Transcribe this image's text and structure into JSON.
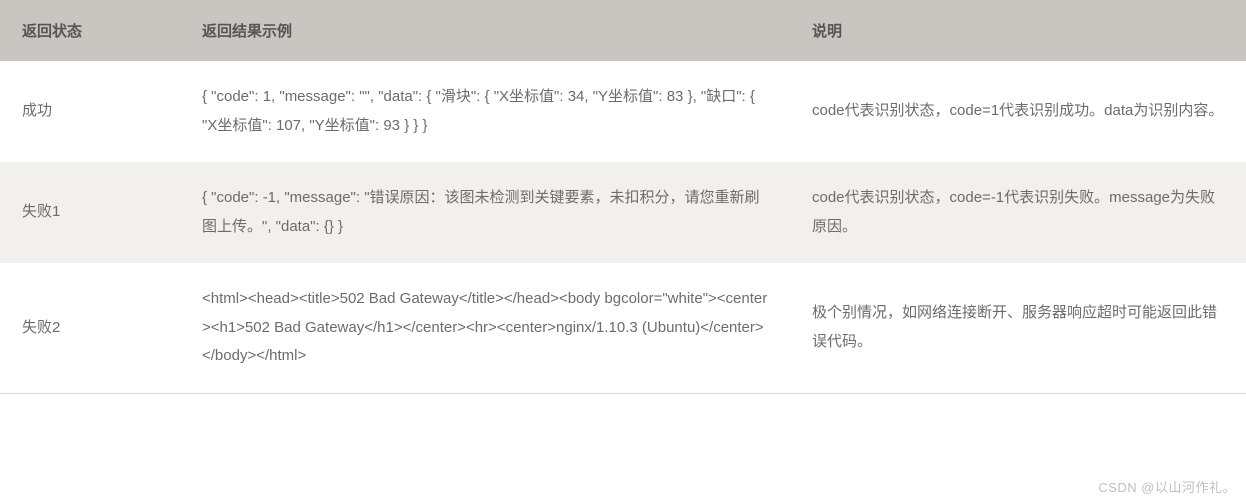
{
  "table": {
    "headers": {
      "status": "返回状态",
      "example": "返回结果示例",
      "description": "说明"
    },
    "rows": [
      {
        "status": "成功",
        "example": "{ \"code\": 1, \"message\": \"\", \"data\": { \"滑块\": { \"X坐标值\": 34, \"Y坐标值\": 83 }, \"缺口\": { \"X坐标值\": 107, \"Y坐标值\": 93 } } }",
        "description": "code代表识别状态，code=1代表识别成功。data为识别内容。"
      },
      {
        "status": "失败1",
        "example": "{ \"code\": -1, \"message\": \"错误原因：该图未检测到关键要素，未扣积分，请您重新刷图上传。\", \"data\": {} }",
        "description": "code代表识别状态，code=-1代表识别失败。message为失败原因。"
      },
      {
        "status": "失败2",
        "example": "<html><head><title>502 Bad Gateway</title></head><body bgcolor=\"white\"><center><h1>502 Bad Gateway</h1></center><hr><center>nginx/1.10.3 (Ubuntu)</center></body></html>",
        "description": "极个别情况，如网络连接断开、服务器响应超时可能返回此错误代码。"
      }
    ]
  },
  "watermark": "CSDN @以山河作礼。"
}
